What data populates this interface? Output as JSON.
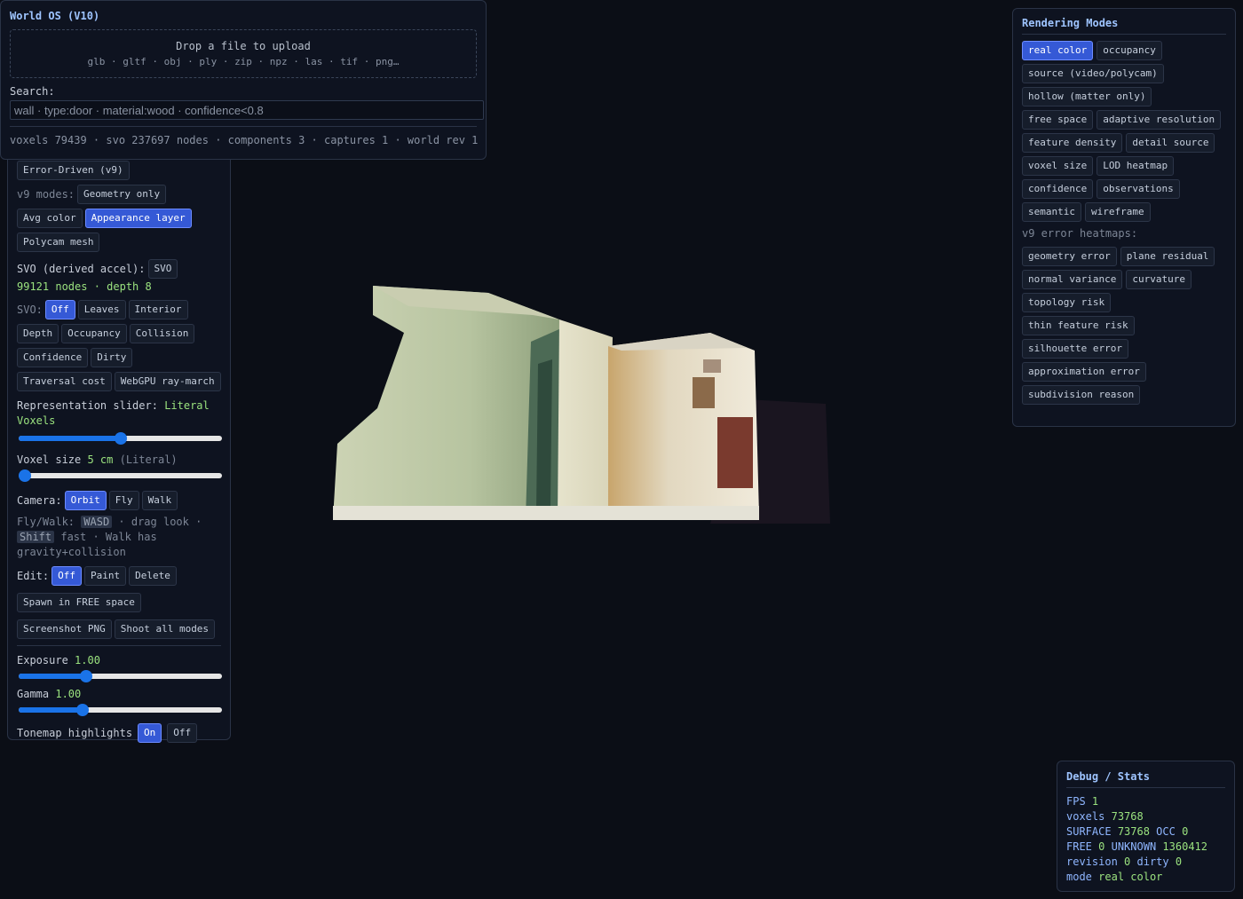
{
  "world": {
    "title": "World OS (V10)",
    "drop_label": "Drop a file to upload",
    "formats": "glb · gltf · obj · ply · zip · npz · las · tif · png…",
    "search_label": "Search:",
    "search_placeholder": "wall · type:door · material:wood · confidence<0.8",
    "stats": "voxels 79439 · svo 237697 nodes · components 3 · captures 1 · world rev 1"
  },
  "controls": {
    "error_driven": "Error-Driven (v9)",
    "v9_modes_label": "v9 modes:",
    "geometry_only": "Geometry only",
    "avg_color": "Avg color",
    "appearance_layer": "Appearance layer",
    "polycam_mesh": "Polycam mesh",
    "svo_label": "SVO (derived accel):",
    "svo_btn": "SVO",
    "svo_nodes": "99121 nodes · depth 8",
    "svo_mode_label": "SVO:",
    "svo_off": "Off",
    "svo_leaves": "Leaves",
    "svo_interior": "Interior",
    "svo_depth": "Depth",
    "svo_occupancy": "Occupancy",
    "svo_collision": "Collision",
    "svo_confidence": "Confidence",
    "svo_dirty": "Dirty",
    "svo_traversal": "Traversal cost",
    "svo_webgpu": "WebGPU ray-march",
    "repr_label": "Representation slider:",
    "repr_value_1": "Literal",
    "repr_value_2": "Voxels",
    "repr_level": 0.5,
    "voxel_size_label": "Voxel size",
    "voxel_size_value": "5 cm",
    "voxel_size_note": "(Literal)",
    "voxel_size_level": 0.0,
    "camera_label": "Camera:",
    "cam_orbit": "Orbit",
    "cam_fly": "Fly",
    "cam_walk": "Walk",
    "help_prefix": "Fly/Walk:",
    "key_wasd": "WASD",
    "help_mid": "· drag look ·",
    "key_shift": "Shift",
    "help_suffix": "fast · Walk has gravity+collision",
    "edit_label": "Edit:",
    "edit_off": "Off",
    "edit_paint": "Paint",
    "edit_delete": "Delete",
    "spawn": "Spawn in FREE space",
    "screenshot": "Screenshot PNG",
    "shoot_all": "Shoot all modes",
    "exposure_label": "Exposure",
    "exposure_value": "1.00",
    "exposure_level": 0.32,
    "gamma_label": "Gamma",
    "gamma_value": "1.00",
    "gamma_level": 0.3,
    "tonemap_label": "Tonemap highlights",
    "tonemap_on": "On",
    "tonemap_off": "Off"
  },
  "modes": {
    "title": "Rendering Modes",
    "rows": [
      [
        "real color",
        "occupancy"
      ],
      [
        "source (video/polycam)"
      ],
      [
        "hollow (matter only)"
      ],
      [
        "free space",
        "adaptive resolution"
      ],
      [
        "feature density",
        "detail source"
      ],
      [
        "voxel size",
        "LOD heatmap"
      ],
      [
        "confidence",
        "observations"
      ],
      [
        "semantic",
        "wireframe"
      ]
    ],
    "active": "real color",
    "heatmap_label": "v9 error heatmaps:",
    "heatmap_rows": [
      [
        "geometry error",
        "plane residual"
      ],
      [
        "normal variance",
        "curvature"
      ],
      [
        "topology risk"
      ],
      [
        "thin feature risk"
      ],
      [
        "silhouette error"
      ],
      [
        "approximation error"
      ],
      [
        "subdivision reason"
      ]
    ]
  },
  "debug": {
    "title": "Debug / Stats",
    "fps_k": "FPS",
    "fps_v": "1",
    "voxels_k": "voxels",
    "voxels_v": "73768",
    "surface_k": "SURFACE",
    "surface_v": "73768",
    "occ_k": "OCC",
    "occ_v": "0",
    "free_k": "FREE",
    "free_v": "0",
    "unknown_k": "UNKNOWN",
    "unknown_v": "1360412",
    "rev_k": "revision",
    "rev_v": "0",
    "dirty_k": "dirty",
    "dirty_v": "0",
    "mode_k": "mode",
    "mode_v": "real color"
  },
  "colors": {
    "accent": "#3559d6",
    "slider": "#1a73e8",
    "value_green": "#9be37f",
    "title_blue": "#9ec4ff"
  }
}
